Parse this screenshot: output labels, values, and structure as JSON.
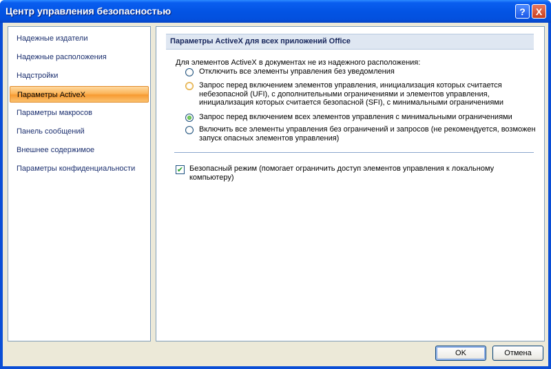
{
  "window": {
    "title": "Центр управления безопасностью"
  },
  "titlebar_buttons": {
    "help": "?",
    "close": "X"
  },
  "sidebar": {
    "items": [
      {
        "label": "Надежные издатели"
      },
      {
        "label": "Надежные расположения"
      },
      {
        "label": "Надстройки"
      },
      {
        "label": "Параметры ActiveX",
        "selected": true
      },
      {
        "label": "Параметры макросов"
      },
      {
        "label": "Панель сообщений"
      },
      {
        "label": "Внешнее содержимое"
      },
      {
        "label": "Параметры конфиденциальности"
      }
    ]
  },
  "main": {
    "section_title": "Параметры ActiveX для всех приложений Office",
    "intro": "Для элементов ActiveX в документах не из надежного расположения:",
    "options": [
      {
        "label": "Отключить все элементы управления без уведомления",
        "checked": false
      },
      {
        "label": "Запрос перед включением элементов управления, инициализация которых считается небезопасной (UFI), с дополнительными ограничениями и элементов управления, инициализация которых считается безопасной (SFI), с минимальными ограничениями",
        "checked": false
      },
      {
        "label": "Запрос перед включением всех элементов управления с минимальными ограничениями",
        "checked": true
      },
      {
        "label": "Включить все элементы управления без ограничений и запросов (не рекомендуется, возможен запуск опасных элементов управления)",
        "checked": false
      }
    ],
    "safe_mode": {
      "label": "Безопасный режим (помогает ограничить доступ элементов управления к локальному компьютеру)",
      "checked": true
    }
  },
  "footer": {
    "ok_label": "OK",
    "cancel_label": "Отмена"
  }
}
